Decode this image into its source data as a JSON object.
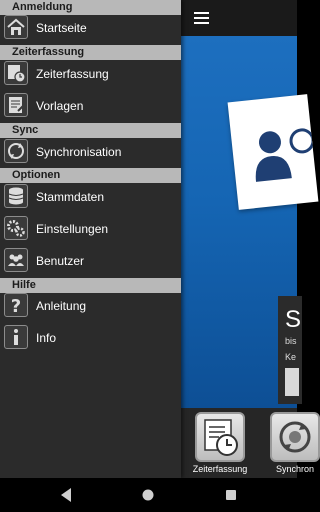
{
  "drawer": {
    "sections": [
      {
        "title": "Anmeldung",
        "items": [
          {
            "label": "Startseite",
            "icon": "home-icon"
          }
        ]
      },
      {
        "title": "Zeiterfassung",
        "items": [
          {
            "label": "Zeiterfassung",
            "icon": "clock-icon"
          },
          {
            "label": "Vorlagen",
            "icon": "template-icon"
          }
        ]
      },
      {
        "title": "Sync",
        "items": [
          {
            "label": "Synchronisation",
            "icon": "sync-icon"
          }
        ]
      },
      {
        "title": "Optionen",
        "items": [
          {
            "label": "Stammdaten",
            "icon": "database-icon"
          },
          {
            "label": "Einstellungen",
            "icon": "gears-icon"
          },
          {
            "label": "Benutzer",
            "icon": "users-icon"
          }
        ]
      },
      {
        "title": "Hilfe",
        "items": [
          {
            "label": "Anleitung",
            "icon": "question-icon"
          },
          {
            "label": "Info",
            "icon": "info-icon"
          }
        ]
      }
    ]
  },
  "hero": {
    "heading": "S",
    "line1": "bis",
    "line2": "Ke"
  },
  "bottom_bar": {
    "items": [
      {
        "label": "Zeiterfassung",
        "icon": "clock-icon"
      },
      {
        "label": "Synchron",
        "icon": "sync-icon"
      }
    ]
  },
  "colors": {
    "drawer_bg": "#2b2b2b",
    "section_bg": "#b8b8b8",
    "hero_blue": "#1565b3"
  }
}
